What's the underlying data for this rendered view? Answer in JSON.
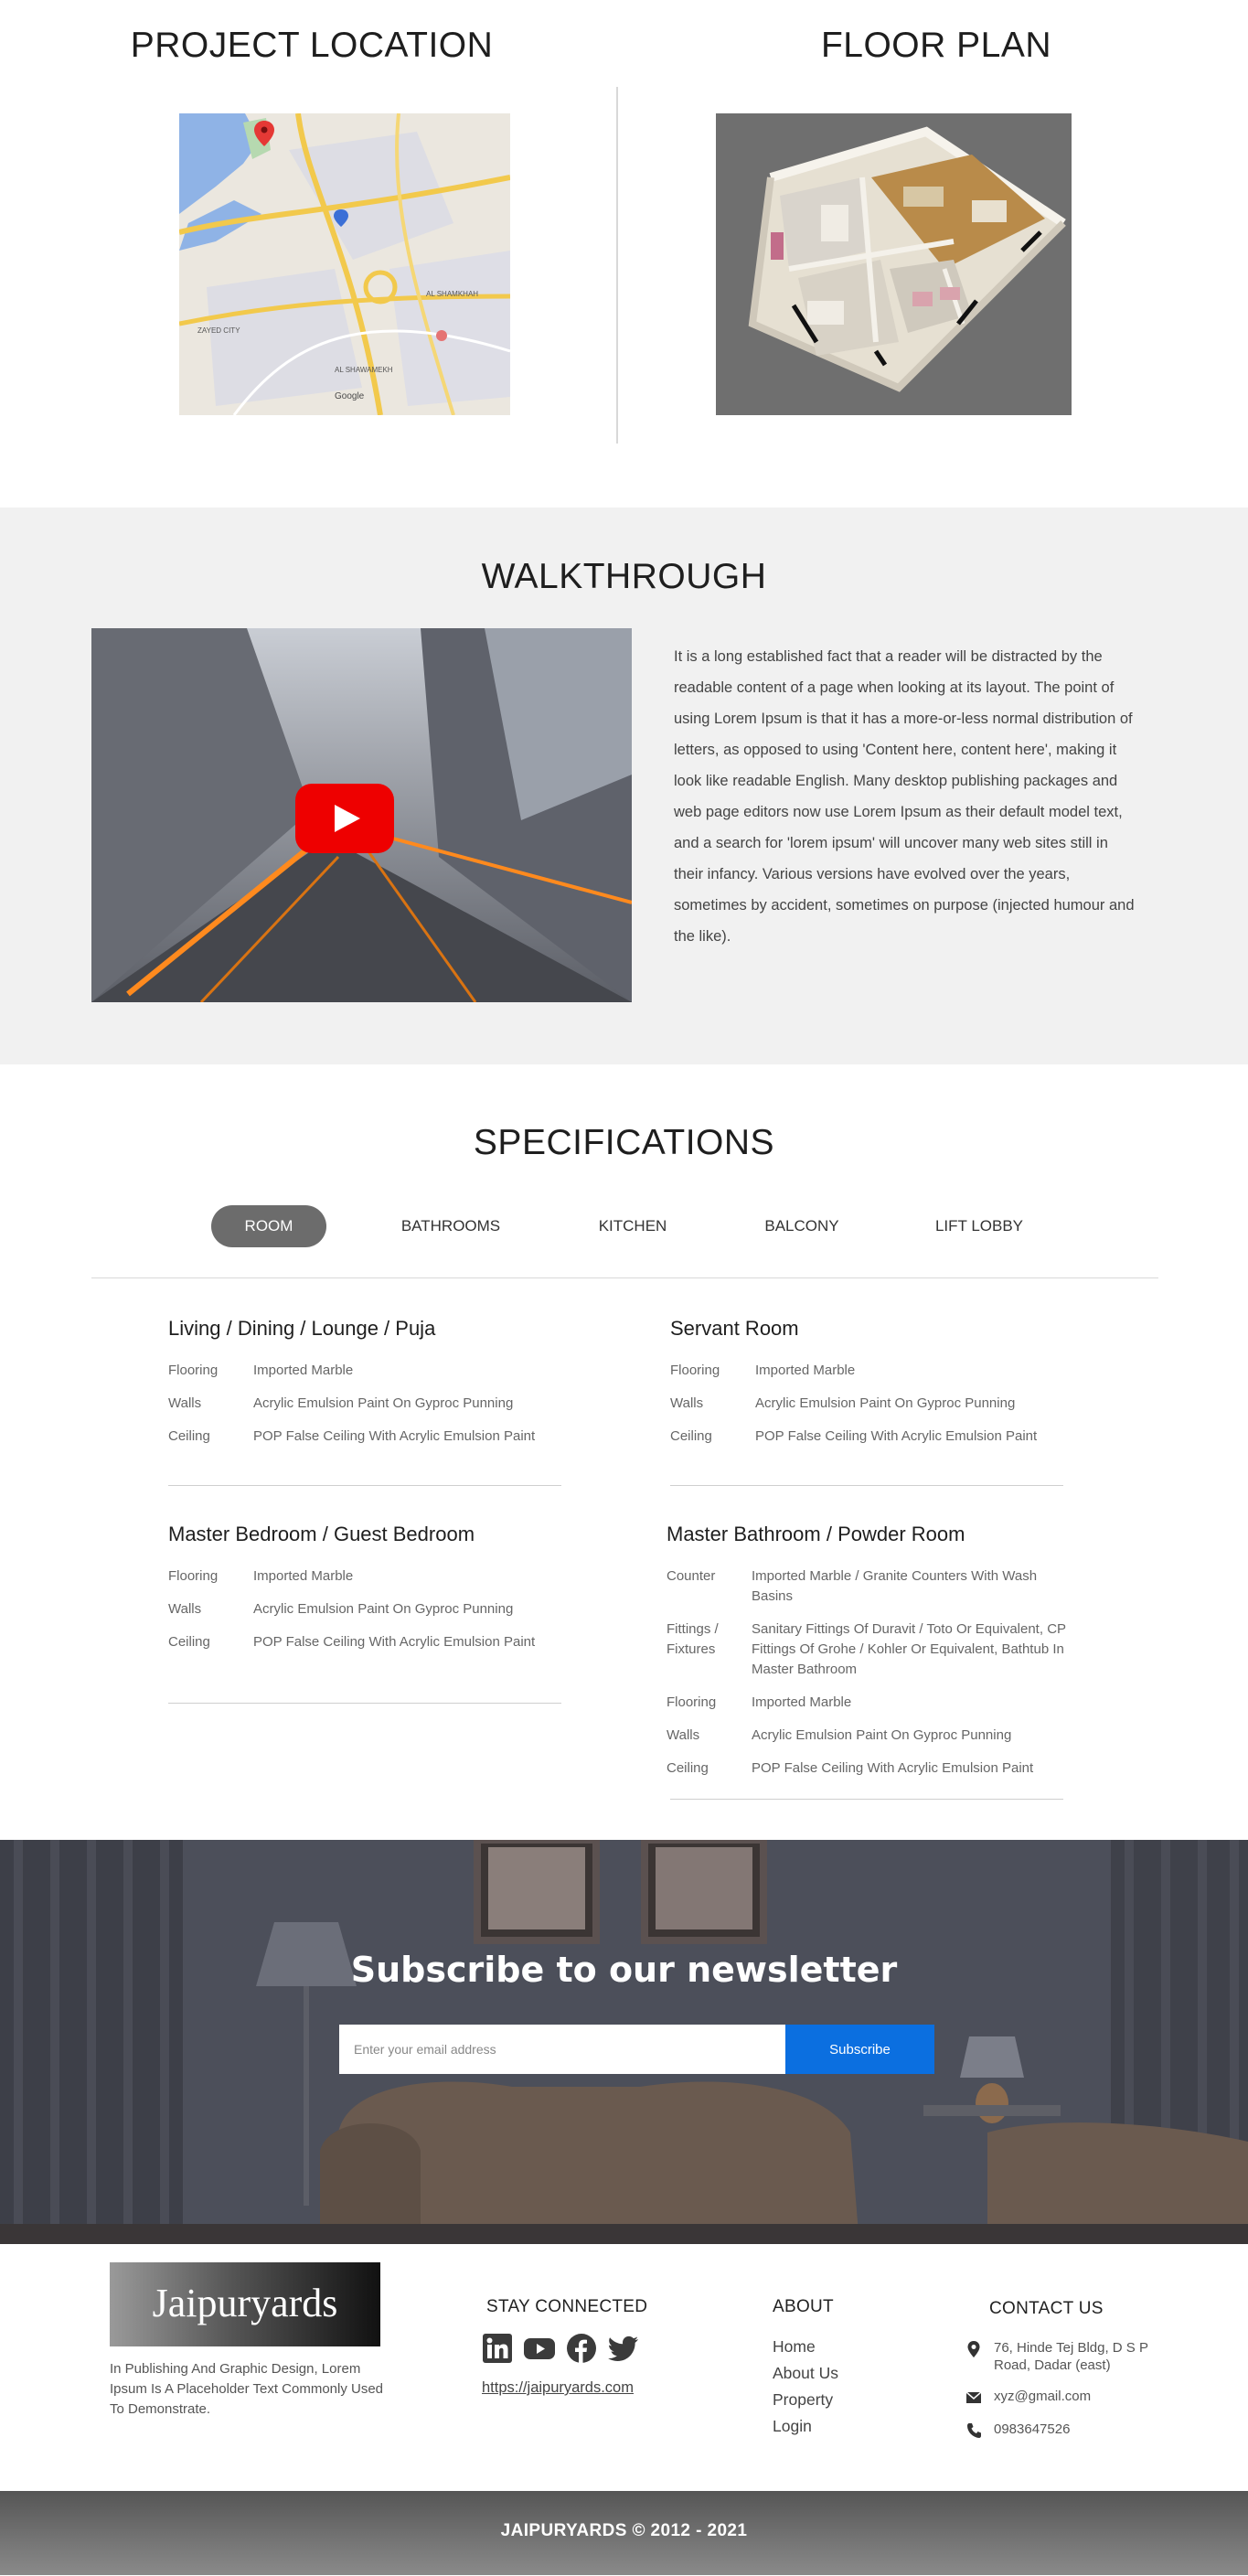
{
  "location": {
    "title": "PROJECT LOCATION",
    "map_icon": "map-image"
  },
  "floorplan": {
    "title": "FLOOR PLAN",
    "image_icon": "floor-plan-image"
  },
  "walkthrough": {
    "title": "WALKTHROUGH",
    "video_icon": "video-thumbnail",
    "play_icon": "youtube-play-icon",
    "description": "It is a long established fact that a reader will be distracted by the readable content of a page when looking at its layout. The point of using Lorem Ipsum is that it has a more-or-less normal distribution of letters, as opposed to using 'Content here, content here', making it look like readable English. Many desktop publishing packages and web page editors now use Lorem Ipsum as their default model text, and a search for 'lorem ipsum' will uncover many web sites still in their infancy. Various versions have evolved over the years, sometimes by accident, sometimes on purpose (injected humour and the like)."
  },
  "specifications": {
    "title": "SPECIFICATIONS",
    "tabs": [
      {
        "label": "ROOM",
        "active": true
      },
      {
        "label": "BATHROOMS",
        "active": false
      },
      {
        "label": "KITCHEN",
        "active": false
      },
      {
        "label": "BALCONY",
        "active": false
      },
      {
        "label": "LIFT LOBBY",
        "active": false
      }
    ],
    "blocks": [
      {
        "title": "Living / Dining / Lounge / Puja",
        "rows": [
          {
            "key": "Flooring",
            "value": "Imported Marble"
          },
          {
            "key": "Walls",
            "value": "Acrylic Emulsion Paint On Gyproc Punning"
          },
          {
            "key": "Ceiling",
            "value": "POP False Ceiling With Acrylic Emulsion Paint"
          }
        ]
      },
      {
        "title": "Servant Room",
        "rows": [
          {
            "key": "Flooring",
            "value": "Imported Marble"
          },
          {
            "key": "Walls",
            "value": "Acrylic Emulsion Paint On Gyproc Punning"
          },
          {
            "key": "Ceiling",
            "value": "POP False Ceiling With Acrylic Emulsion Paint"
          }
        ]
      },
      {
        "title": "Master Bedroom / Guest Bedroom",
        "rows": [
          {
            "key": "Flooring",
            "value": "Imported Marble"
          },
          {
            "key": "Walls",
            "value": "Acrylic Emulsion Paint On Gyproc Punning"
          },
          {
            "key": "Ceiling",
            "value": "POP False Ceiling With Acrylic Emulsion Paint"
          }
        ]
      },
      {
        "title": "Master Bathroom / Powder Room",
        "rows": [
          {
            "key": "Counter",
            "value": "Imported Marble / Granite Counters With Wash Basins"
          },
          {
            "key": "Fittings / Fixtures",
            "value": "Sanitary Fittings Of Duravit / Toto Or Equivalent, CP Fittings Of Grohe / Kohler Or Equivalent, Bathtub In Master Bathroom"
          },
          {
            "key": "Flooring",
            "value": "Imported Marble"
          },
          {
            "key": "Walls",
            "value": "Acrylic Emulsion Paint On Gyproc Punning"
          },
          {
            "key": "Ceiling",
            "value": "POP False Ceiling With Acrylic Emulsion Paint"
          }
        ]
      }
    ]
  },
  "newsletter": {
    "title": "Subscribe to our newsletter",
    "input_placeholder": "Enter your email address",
    "button_label": "Subscribe",
    "button_color": "#0b6fe0",
    "background_icon": "living-room-image"
  },
  "footer": {
    "logo_text": "Jaipuryards",
    "description": "In Publishing And Graphic Design, Lorem Ipsum Is A Placeholder Text Commonly Used To Demonstrate.",
    "stay_connected": {
      "heading": "STAY CONNECTED",
      "social_icons": [
        "linkedin-icon",
        "youtube-icon",
        "facebook-icon",
        "twitter-icon"
      ],
      "site_url": "https://jaipuryards.com"
    },
    "about": {
      "heading": "ABOUT",
      "links": [
        "Home",
        "About Us",
        "Property",
        "Login"
      ]
    },
    "contact": {
      "heading": "CONTACT US",
      "address": "76, Hinde Tej Bldg, D S P Road, Dadar (east)",
      "email": "xyz@gmail.com",
      "phone": "0983647526"
    }
  },
  "copyright": "JAIPURYARDS © 2012 - 2021"
}
